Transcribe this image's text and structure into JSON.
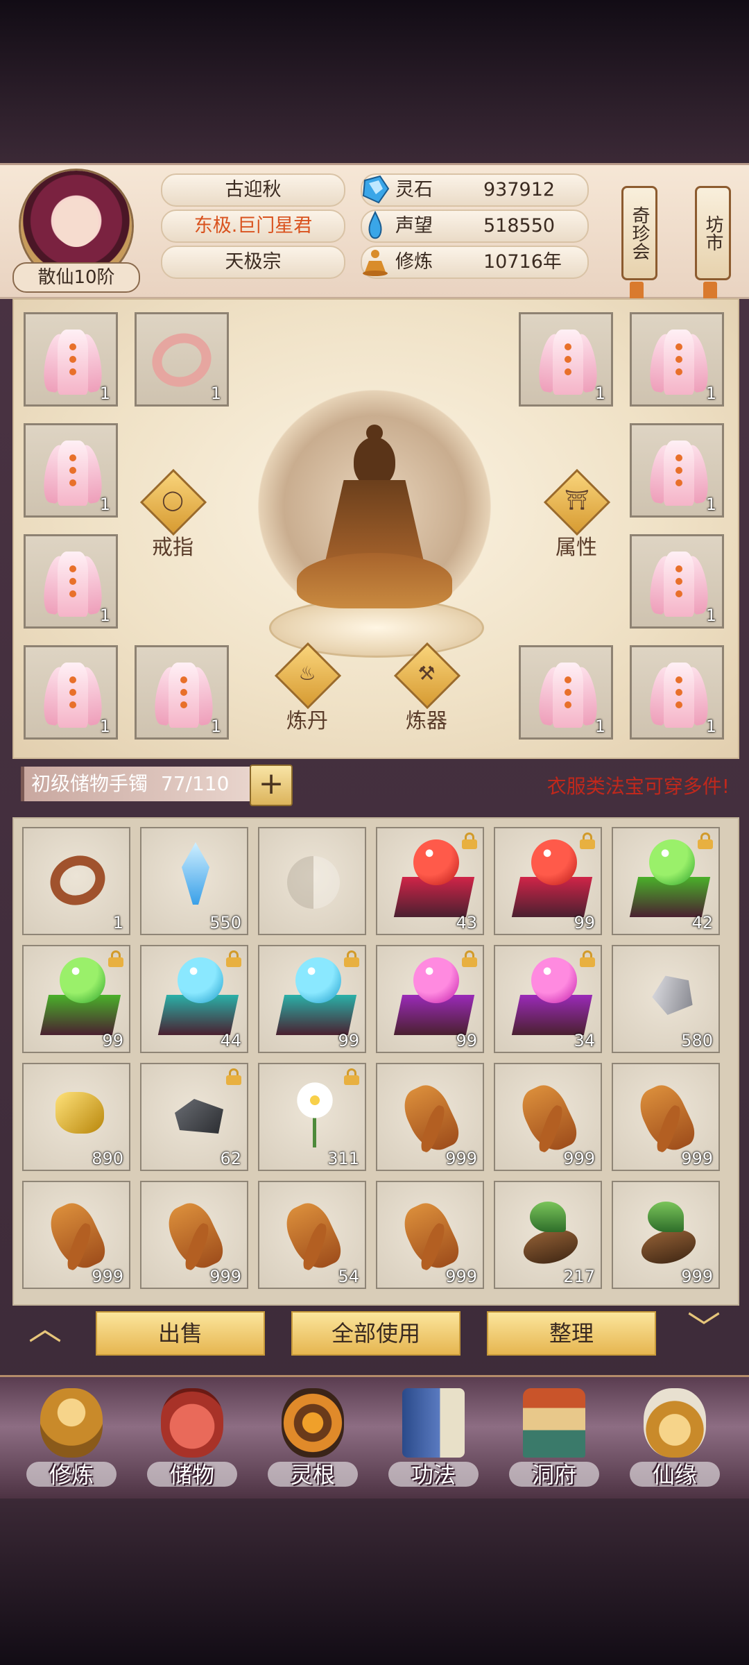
{
  "player": {
    "name": "古迎秋",
    "title": "东极.巨门星君",
    "sect": "天极宗",
    "rank": "散仙10阶"
  },
  "resources": [
    {
      "icon": "spirit-stone-icon",
      "label": "灵石",
      "value": "937912"
    },
    {
      "icon": "prestige-drop-icon",
      "label": "声望",
      "value": "518550"
    },
    {
      "icon": "meditation-icon",
      "label": "修炼",
      "value": "10716年"
    }
  ],
  "side_tabs": [
    "奇珍会",
    "坊市"
  ],
  "equip_actions": {
    "ring": "戒指",
    "attributes": "属性",
    "alchemy": "炼丹",
    "forge": "炼器"
  },
  "equip_slots": [
    {
      "item": "pink-robe",
      "count": "1"
    },
    {
      "item": "jade-ring",
      "count": "1"
    },
    {
      "item": "pink-robe",
      "count": "1"
    },
    {
      "item": "pink-robe",
      "count": "1"
    },
    {
      "item": "pink-robe",
      "count": "1"
    },
    {
      "item": "pink-robe",
      "count": "1"
    },
    {
      "item": "pink-robe",
      "count": "1"
    },
    {
      "item": "pink-robe",
      "count": "1"
    },
    {
      "item": "pink-robe",
      "count": "1"
    },
    {
      "item": "pink-robe",
      "count": "1"
    },
    {
      "item": "pink-robe",
      "count": "1"
    },
    {
      "item": "pink-robe",
      "count": "1"
    }
  ],
  "storage": {
    "name": "初级储物手镯",
    "capacity": "77/110",
    "add_label": "+",
    "notice": "衣服类法宝可穿多件!"
  },
  "inventory": [
    {
      "item": "ring",
      "count": "1",
      "locked": false
    },
    {
      "item": "blue-crystal",
      "count": "550",
      "locked": false
    },
    {
      "item": "empty",
      "count": "",
      "locked": false
    },
    {
      "item": "red-orb-box",
      "count": "43",
      "locked": true
    },
    {
      "item": "red-orb-box",
      "count": "99",
      "locked": true
    },
    {
      "item": "green-orb-box",
      "count": "42",
      "locked": true
    },
    {
      "item": "green-orb-box",
      "count": "99",
      "locked": true
    },
    {
      "item": "cyan-orb-box",
      "count": "44",
      "locked": true
    },
    {
      "item": "cyan-orb-box",
      "count": "99",
      "locked": true
    },
    {
      "item": "magenta-orb-box",
      "count": "99",
      "locked": true
    },
    {
      "item": "magenta-orb-box",
      "count": "34",
      "locked": true
    },
    {
      "item": "silver-stone",
      "count": "580",
      "locked": false
    },
    {
      "item": "gold-ore",
      "count": "890",
      "locked": false
    },
    {
      "item": "dark-rock",
      "count": "62",
      "locked": true
    },
    {
      "item": "white-flower",
      "count": "311",
      "locked": true
    },
    {
      "item": "ginseng",
      "count": "999",
      "locked": false
    },
    {
      "item": "ginseng",
      "count": "999",
      "locked": false
    },
    {
      "item": "ginseng",
      "count": "999",
      "locked": false
    },
    {
      "item": "ginseng",
      "count": "999",
      "locked": false
    },
    {
      "item": "ginseng",
      "count": "999",
      "locked": false
    },
    {
      "item": "ginseng",
      "count": "54",
      "locked": false
    },
    {
      "item": "ginseng",
      "count": "999",
      "locked": false
    },
    {
      "item": "leaf-herb",
      "count": "217",
      "locked": false
    },
    {
      "item": "leaf-herb",
      "count": "999",
      "locked": false
    }
  ],
  "actions": {
    "sell": "出售",
    "use_all": "全部使用",
    "sort": "整理"
  },
  "nav": [
    {
      "label": "修炼",
      "icon": "cultivation-icon"
    },
    {
      "label": "储物",
      "icon": "storage-bag-icon"
    },
    {
      "label": "灵根",
      "icon": "spirit-root-icon"
    },
    {
      "label": "功法",
      "icon": "technique-book-icon"
    },
    {
      "label": "洞府",
      "icon": "cave-mansion-icon"
    },
    {
      "label": "仙缘",
      "icon": "fortune-gourd-icon"
    }
  ],
  "colors": {
    "notice": "#c0281c",
    "accent_gold": "#e6b651",
    "panel": "#f0e2c7"
  }
}
